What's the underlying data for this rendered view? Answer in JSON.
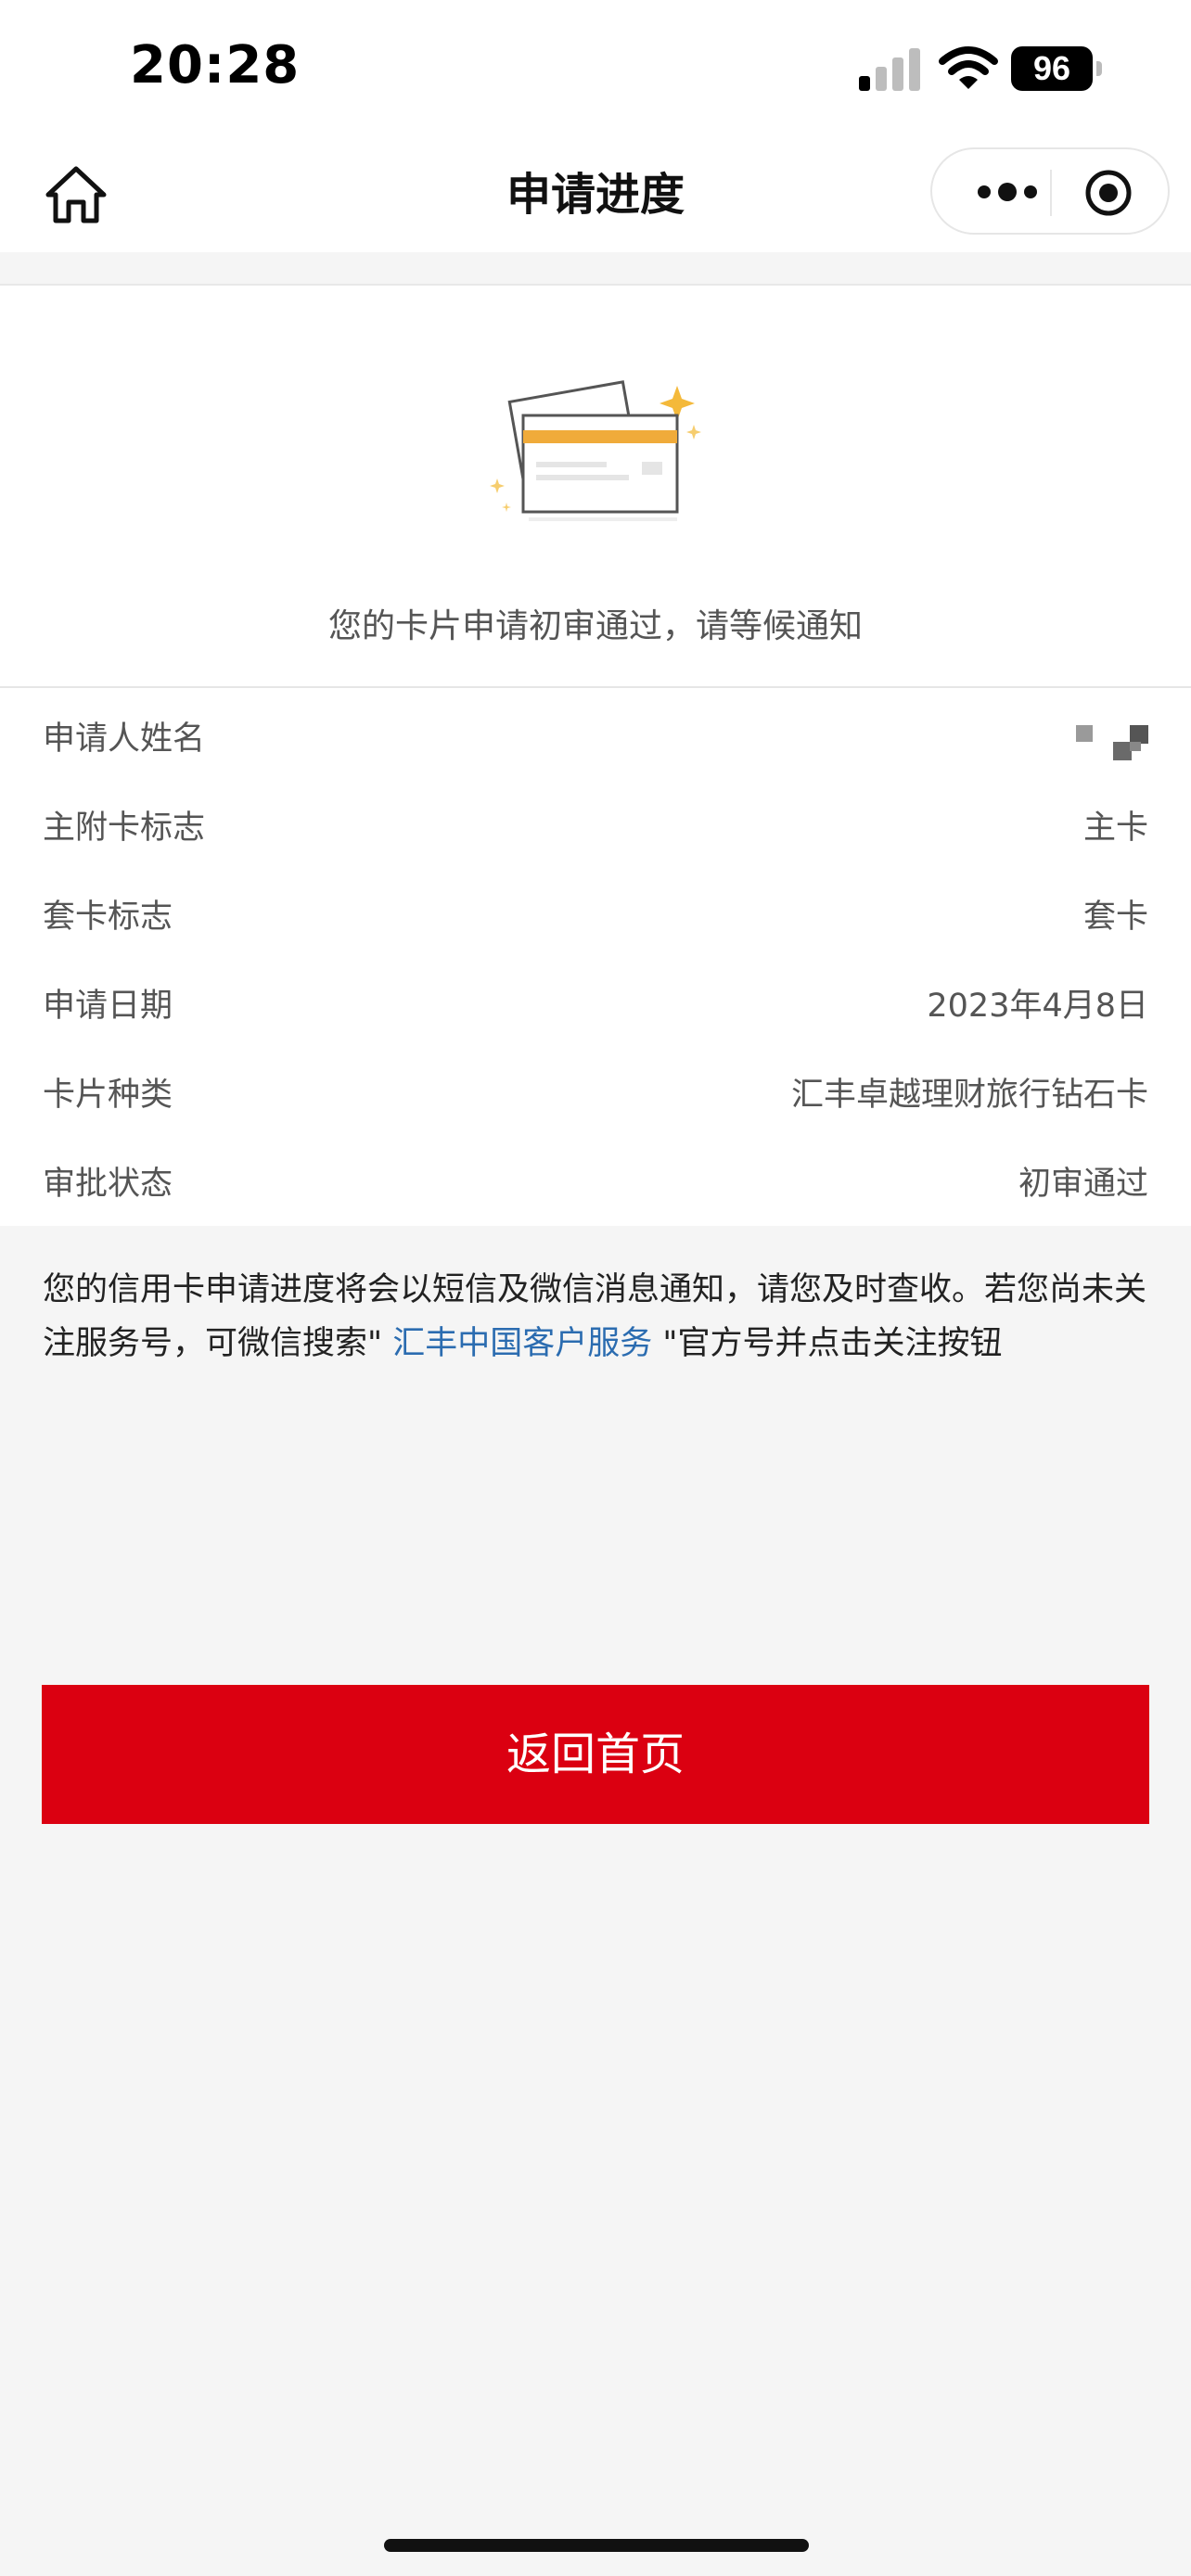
{
  "status_bar": {
    "time": "20:28",
    "battery": "96"
  },
  "nav": {
    "title": "申请进度"
  },
  "hero": {
    "message": "您的卡片申请初审通过，请等候通知"
  },
  "info_rows": [
    {
      "label": "申请人姓名",
      "value": ""
    },
    {
      "label": "主附卡标志",
      "value": "主卡"
    },
    {
      "label": "套卡标志",
      "value": "套卡"
    },
    {
      "label": "申请日期",
      "value": "2023年4月8日"
    },
    {
      "label": "卡片种类",
      "value": "汇丰卓越理财旅行钻石卡"
    },
    {
      "label": "审批状态",
      "value": "初审通过"
    }
  ],
  "notice": {
    "text_1": "您的信用卡申请进度将会以短信及微信消息通知，请您及时查收。若您尚未关注服务号，可微信搜索\"",
    "link": " 汇丰中国客户服务 ",
    "text_2": "\"官方号并点击关注按钮"
  },
  "return_button": {
    "label": "返回首页"
  },
  "colors": {
    "accent": "#db0011",
    "link": "#2b6cb0"
  }
}
